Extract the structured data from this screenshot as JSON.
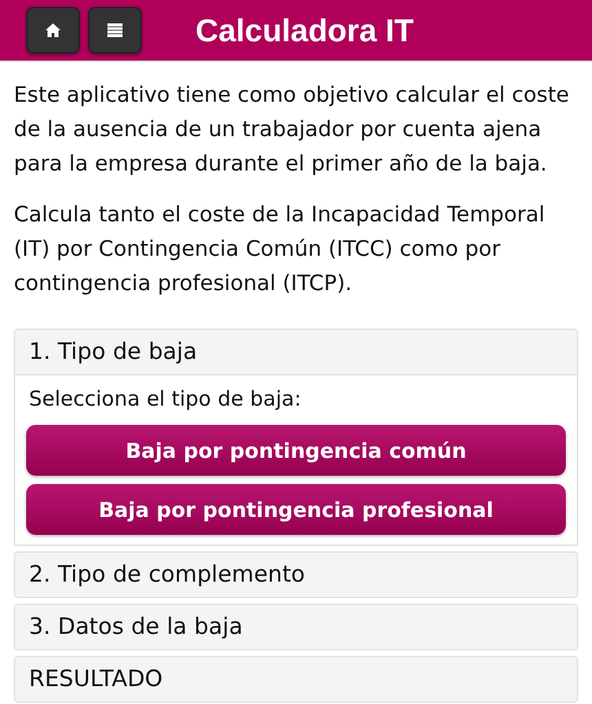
{
  "header": {
    "title": "Calculadora IT"
  },
  "intro": [
    "Este aplicativo tiene como objetivo calcular el coste de la ausencia de un trabajador por cuenta ajena para la empresa durante el primer año de la baja.",
    "Calcula tanto el coste de la Incapacidad Temporal (IT) por Contingencia Común (ITCC) como por contingencia profesional (ITCP)."
  ],
  "sections": [
    {
      "title": "1. Tipo de baja",
      "expanded": true,
      "prompt": "Selecciona el tipo de baja:",
      "buttons": [
        "Baja por pontingencia común",
        "Baja por pontingencia profesional"
      ]
    },
    {
      "title": "2. Tipo de complemento",
      "expanded": false
    },
    {
      "title": "3. Datos de la baja",
      "expanded": false
    },
    {
      "title": "RESULTADO",
      "expanded": false
    }
  ]
}
